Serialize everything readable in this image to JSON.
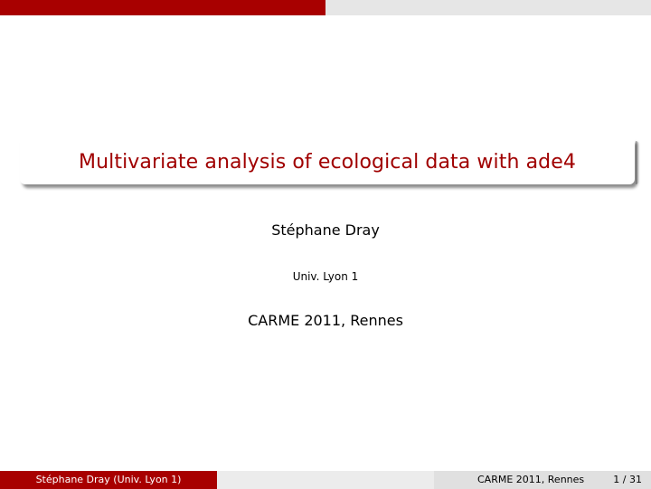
{
  "header": {
    "bar_colors": [
      "#a80000",
      "#e6e6e6"
    ]
  },
  "slide": {
    "title": "Multivariate analysis of ecological data with ade4",
    "title_color": "#a00000",
    "author": "Stéphane Dray",
    "institute": "Univ. Lyon 1",
    "date": "CARME 2011, Rennes"
  },
  "footer": {
    "left": "Stéphane Dray  (Univ. Lyon 1)",
    "center": "CARME 2011, Rennes",
    "page": "1 / 31"
  }
}
